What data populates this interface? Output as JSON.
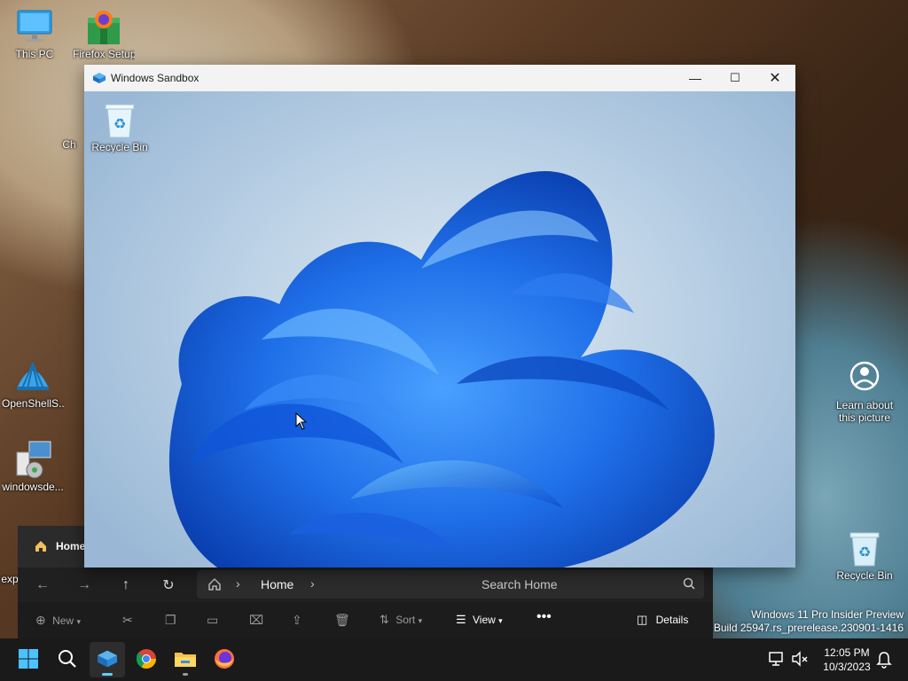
{
  "desktop_icons": [
    {
      "label": "This PC"
    },
    {
      "label": "Firefox Setup"
    },
    {
      "label": "Ch"
    },
    {
      "label": "OpenShellS..."
    },
    {
      "label": "windowsde..."
    },
    {
      "label": "exp"
    },
    {
      "label": "Learn about this picture"
    },
    {
      "label": "Recycle Bin"
    }
  ],
  "sandbox": {
    "title": "Windows Sandbox",
    "icons": [
      {
        "label": "Recycle Bin"
      }
    ]
  },
  "explorer": {
    "tab_title": "Home",
    "breadcrumb": "Home",
    "search_placeholder": "Search Home",
    "commands": {
      "new": "New",
      "sort": "Sort",
      "view": "View",
      "details": "Details"
    }
  },
  "watermark": {
    "line1": "Windows 11 Pro Insider Preview",
    "line2": "y. Build 25947.rs_prerelease.230901-1416"
  },
  "taskbar": {
    "time": "12:05 PM",
    "date": "10/3/2023"
  },
  "colors": {
    "accent": "#60cdff",
    "bloom_blue": "#1f6fe8"
  }
}
